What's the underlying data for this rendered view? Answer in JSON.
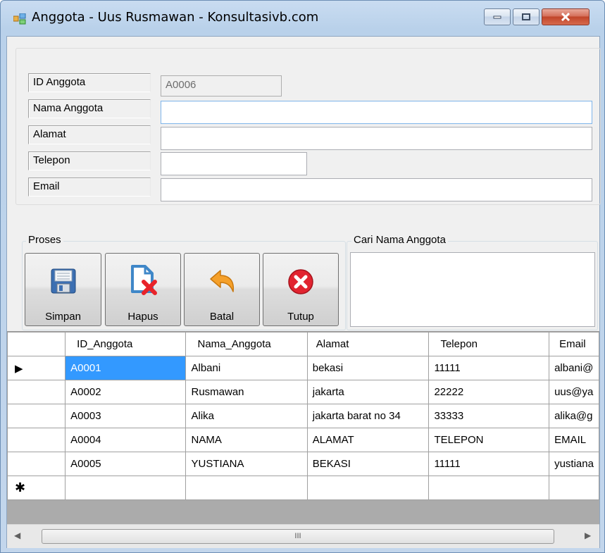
{
  "window": {
    "title": "Anggota - Uus Rusmawan - Konsultasivb.com"
  },
  "form": {
    "fields": [
      {
        "label": "ID Anggota",
        "value": "A0006",
        "readonly": true
      },
      {
        "label": "Nama Anggota",
        "value": ""
      },
      {
        "label": "Alamat",
        "value": ""
      },
      {
        "label": "Telepon",
        "value": ""
      },
      {
        "label": "Email",
        "value": ""
      }
    ]
  },
  "proses": {
    "group_label": "Proses",
    "buttons": [
      {
        "label": "Simpan",
        "icon": "floppy-disk-icon"
      },
      {
        "label": "Hapus",
        "icon": "delete-document-icon"
      },
      {
        "label": "Batal",
        "icon": "undo-arrow-icon"
      },
      {
        "label": "Tutup",
        "icon": "close-circle-icon"
      }
    ]
  },
  "search": {
    "group_label": "Cari Nama Anggota",
    "value": ""
  },
  "grid": {
    "columns": [
      "ID_Anggota",
      "Nama_Anggota",
      "Alamat",
      "Telepon",
      "Email"
    ],
    "rows": [
      [
        "A0001",
        "Albani",
        "bekasi",
        "11111",
        "albani@"
      ],
      [
        "A0002",
        "Rusmawan",
        "jakarta",
        "22222",
        "uus@ya"
      ],
      [
        "A0003",
        "Alika",
        "jakarta barat no 34",
        "33333",
        "alika@g"
      ],
      [
        "A0004",
        "NAMA",
        "ALAMAT",
        "TELEPON",
        "EMAIL"
      ],
      [
        "A0005",
        "YUSTIANA",
        "BEKASI",
        "11111",
        "yustiana"
      ]
    ],
    "current_row_marker": "▶",
    "new_row_marker": "✱",
    "scroll_thumb_glyph": "III"
  },
  "colors": {
    "selection": "#3399ff",
    "close_button": "#c1452a"
  }
}
